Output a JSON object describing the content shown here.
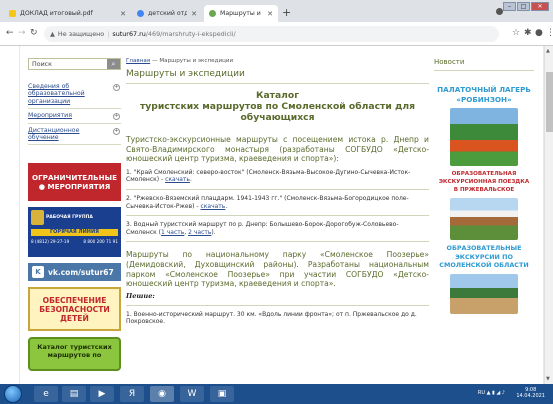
{
  "tabs": [
    {
      "title": "ДОКЛАД итоговый.pdf",
      "color": "#f5c518"
    },
    {
      "title": "детский отдых смоленск – Goo",
      "color": "#4285f4"
    },
    {
      "title": "Маршруты и экспедиции - Бер",
      "color": "#6aa84f"
    }
  ],
  "address": {
    "security": "Не защищено",
    "domain": "sutur67.ru",
    "path": "/469/marshruty-i-ekspedicii/"
  },
  "left": {
    "search_label": "Поиск",
    "nav": [
      "Сведения об образовательной организации",
      "Мероприятия",
      "Дистанционное обучение"
    ],
    "banner_red": [
      "ОГРАНИЧИТЕЛЬНЫЕ",
      "МЕРОПРИЯТИЯ"
    ],
    "banner_blue": {
      "title": "РАБОЧАЯ ГРУППА",
      "hotline": "ГОРЯЧАЯ ЛИНИЯ",
      "phone1": "8 (4812) 29-27-19",
      "phone2": "8 800 200 71 91"
    },
    "vk": "vk.com/sutur67",
    "safety": [
      "ОБЕСПЕЧЕНИЕ",
      "БЕЗОПАСНОСТИ",
      "ДЕТЕЙ"
    ],
    "catalog_btn": [
      "Каталог туристских",
      "маршрутов по"
    ]
  },
  "main": {
    "crumb_home": "Главная",
    "crumb_sep": " — ",
    "crumb_current": "Маршруты и экспедиции",
    "title": "Маршруты и экспедиции",
    "catalog_line1": "Каталог",
    "catalog_line2": "туристских маршрутов по Смоленской области для обучающихся",
    "lead1": "Туристско-экскурсионные маршруты с посещением истока р. Днепр и Свято-Владимирского монастыря (разработаны СОГБУДО «Детско-юношеский центр туризма, краеведения и спорта»):",
    "items": [
      {
        "text": "1. \"Край Смоленский: северо-восток\" (Смоленск-Вязьма-Высокое-Дугино-Сычевка-Исток-Смоленск) - ",
        "link": "скачать",
        "tail": "."
      },
      {
        "text": "2. \"Ржевско-Вяземский плацдарм. 1941-1943 гг.\" (Смоленск-Вязьма-Богородицкое поле-Сычевка-Исток-Ржев) - ",
        "link": "скачать",
        "tail": "."
      },
      {
        "text": "3. Водный туристский маршрут по р. Днепр: Болышево-Борок-Дорогобуж-Соловьево-Смоленск (",
        "link": "1 часть",
        "mid": ", ",
        "link2": "2 часть",
        "tail": ")."
      }
    ],
    "lead2": "Маршруты по национальному парку «Смоленское Поозерье» (Демидовский, Духовщинский районы). Разработаны национальным парком «Смоленское Поозерье» при участии СОГБУДО «Детско-юношеский центр туризма, краеведения и спорта».",
    "walking": "Пешие:",
    "item4": "1. Военно-исторический маршрут. 30 км. «Вдоль линии фронта»; от п. Пржевальское до д. Покровское."
  },
  "right": {
    "news": "Новости",
    "camp": [
      "ПАЛАТОЧНЫЙ ЛАГЕРЬ",
      "«РОБИНЗОН»"
    ],
    "trip": [
      "ОБРАЗОВАТЕЛЬНАЯ",
      "ЭКСКУРСИОННАЯ ПОЕЗДКА",
      "В ПРЖЕВАЛЬСКОЕ"
    ],
    "tours": [
      "ОБРАЗОВАТЕЛЬНЫЕ",
      "ЭКСКУРСИИ ПО",
      "СМОЛЕНСКОЙ ОБЛАСТИ"
    ]
  },
  "taskbar": {
    "lang": "RU",
    "time": "9:08",
    "date": "14.04.2021"
  }
}
